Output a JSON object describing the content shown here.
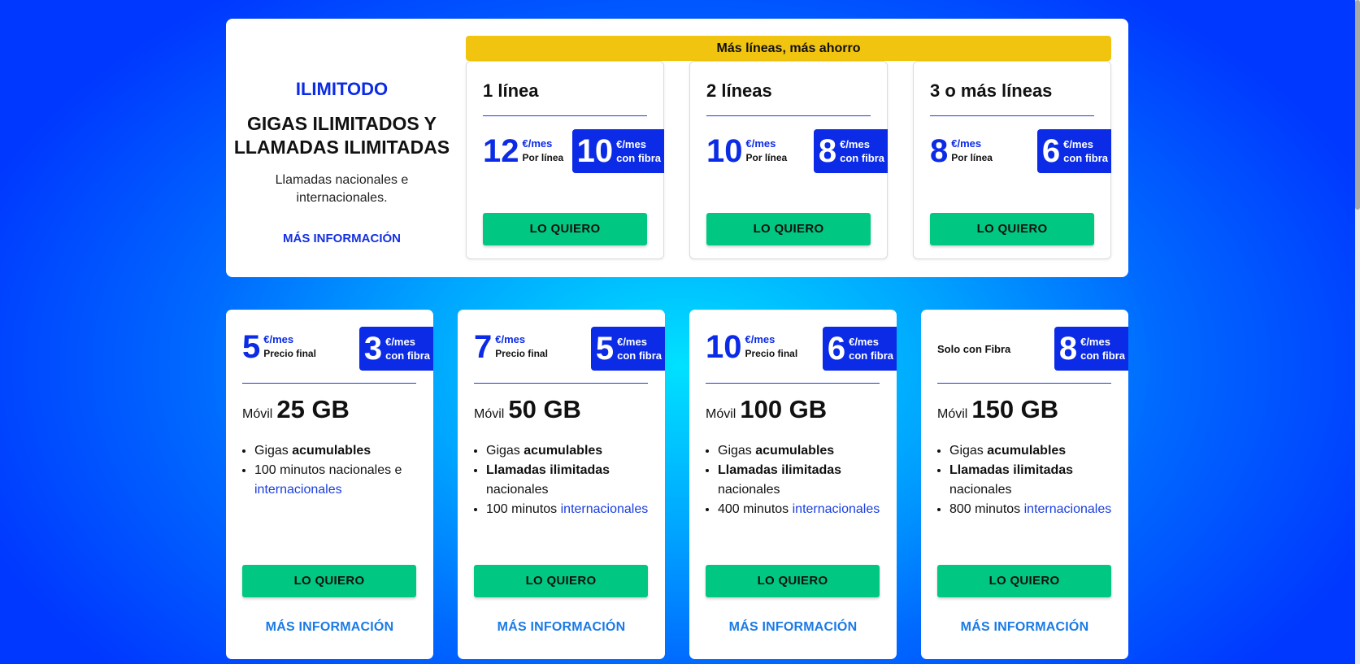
{
  "intro": {
    "brand": "ILIMITODO",
    "headline": "GIGAS ILIMITADOS Y LLAMADAS ILIMITADAS",
    "description": "Llamadas nacionales e internacionales.",
    "more_link": "MÁS INFORMACIÓN"
  },
  "ribbon": "Más líneas, más ahorro",
  "lines": [
    {
      "title": "1 línea",
      "price": "12",
      "unit": "€/mes",
      "price_label": "Por línea",
      "fibra_price": "10",
      "fibra_unit": "€/mes",
      "fibra_label": "con fibra",
      "button": "LO QUIERO"
    },
    {
      "title": "2 líneas",
      "price": "10",
      "unit": "€/mes",
      "price_label": "Por línea",
      "fibra_price": "8",
      "fibra_unit": "€/mes",
      "fibra_label": "con fibra",
      "button": "LO QUIERO"
    },
    {
      "title": "3 o más líneas",
      "price": "8",
      "unit": "€/mes",
      "price_label": "Por línea",
      "fibra_price": "6",
      "fibra_unit": "€/mes",
      "fibra_label": "con fibra",
      "button": "LO QUIERO"
    }
  ],
  "plans": [
    {
      "price": "5",
      "unit": "€/mes",
      "price_label": "Precio final",
      "fibra_price": "3",
      "fibra_unit": "€/mes",
      "fibra_label": "con fibra",
      "data_prefix": "Móvil",
      "data": "25 GB",
      "features": [
        {
          "pre": "Gigas ",
          "bold": "acumulables",
          "post": "",
          "link": ""
        },
        {
          "pre": "100 minutos nacionales e ",
          "bold": "",
          "post": "",
          "link": "internacionales"
        }
      ],
      "button": "LO QUIERO",
      "more": "MÁS INFORMACIÓN"
    },
    {
      "price": "7",
      "unit": "€/mes",
      "price_label": "Precio final",
      "fibra_price": "5",
      "fibra_unit": "€/mes",
      "fibra_label": "con fibra",
      "data_prefix": "Móvil",
      "data": "50 GB",
      "features": [
        {
          "pre": "Gigas ",
          "bold": "acumulables",
          "post": "",
          "link": ""
        },
        {
          "pre": "",
          "bold": "Llamadas ilimitadas",
          "post": " nacionales",
          "link": ""
        },
        {
          "pre": "100 minutos ",
          "bold": "",
          "post": "",
          "link": "internacionales"
        }
      ],
      "button": "LO QUIERO",
      "more": "MÁS INFORMACIÓN"
    },
    {
      "price": "10",
      "unit": "€/mes",
      "price_label": "Precio final",
      "fibra_price": "6",
      "fibra_unit": "€/mes",
      "fibra_label": "con fibra",
      "data_prefix": "Móvil",
      "data": "100 GB",
      "features": [
        {
          "pre": "Gigas ",
          "bold": "acumulables",
          "post": "",
          "link": ""
        },
        {
          "pre": "",
          "bold": "Llamadas ilimitadas",
          "post": " nacionales",
          "link": ""
        },
        {
          "pre": "400 minutos ",
          "bold": "",
          "post": "",
          "link": "internacionales"
        }
      ],
      "button": "LO QUIERO",
      "more": "MÁS INFORMACIÓN"
    },
    {
      "solo_label": "Solo con Fibra",
      "fibra_price": "8",
      "fibra_unit": "€/mes",
      "fibra_label": "con fibra",
      "data_prefix": "Móvil",
      "data": "150 GB",
      "features": [
        {
          "pre": "Gigas ",
          "bold": "acumulables",
          "post": "",
          "link": ""
        },
        {
          "pre": "",
          "bold": "Llamadas ilimitadas",
          "post": " nacionales",
          "link": ""
        },
        {
          "pre": "800 minutos ",
          "bold": "",
          "post": "",
          "link": "internacionales"
        }
      ],
      "button": "LO QUIERO",
      "more": "MÁS INFORMACIÓN"
    }
  ]
}
